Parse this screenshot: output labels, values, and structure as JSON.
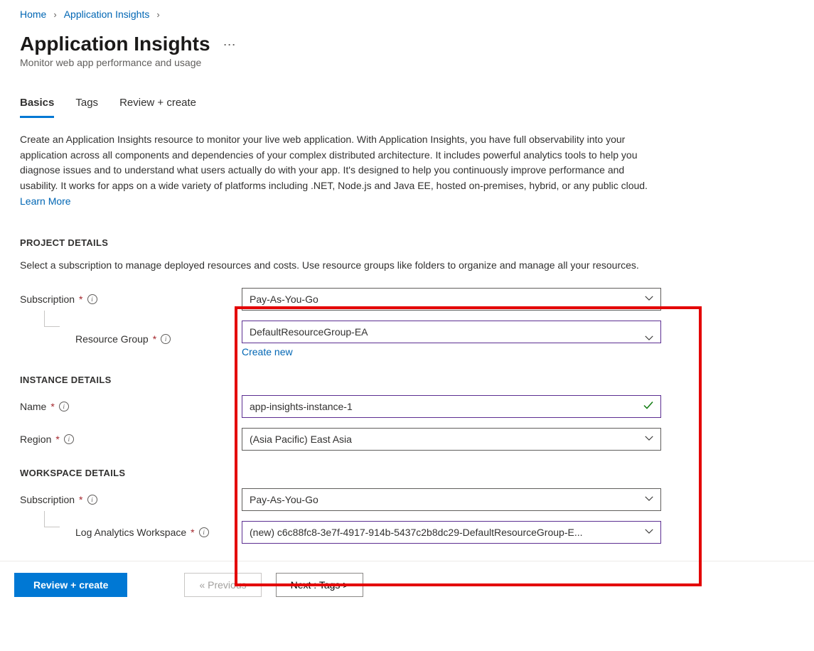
{
  "breadcrumb": {
    "home": "Home",
    "app_insights": "Application Insights"
  },
  "header": {
    "title": "Application Insights",
    "subtitle": "Monitor web app performance and usage"
  },
  "tabs": {
    "basics": "Basics",
    "tags": "Tags",
    "review": "Review + create"
  },
  "intro": {
    "text": "Create an Application Insights resource to monitor your live web application. With Application Insights, you have full observability into your application across all components and dependencies of your complex distributed architecture. It includes powerful analytics tools to help you diagnose issues and to understand what users actually do with your app. It's designed to help you continuously improve performance and usability. It works for apps on a wide variety of platforms including .NET, Node.js and Java EE, hosted on-premises, hybrid, or any public cloud.",
    "learn_more": "Learn More"
  },
  "project": {
    "heading": "PROJECT DETAILS",
    "desc": "Select a subscription to manage deployed resources and costs. Use resource groups like folders to organize and manage all your resources.",
    "subscription_label": "Subscription",
    "subscription_value": "Pay-As-You-Go",
    "resource_group_label": "Resource Group",
    "resource_group_value": "DefaultResourceGroup-EA",
    "create_new": "Create new"
  },
  "instance": {
    "heading": "INSTANCE DETAILS",
    "name_label": "Name",
    "name_value": "app-insights-instance-1",
    "region_label": "Region",
    "region_value": "(Asia Pacific) East Asia"
  },
  "workspace": {
    "heading": "WORKSPACE DETAILS",
    "subscription_label": "Subscription",
    "subscription_value": "Pay-As-You-Go",
    "law_label": "Log Analytics Workspace",
    "law_value": "(new) c6c88fc8-3e7f-4917-914b-5437c2b8dc29-DefaultResourceGroup-E..."
  },
  "footer": {
    "review": "Review + create",
    "previous": "« Previous",
    "next": "Next : Tags >"
  }
}
